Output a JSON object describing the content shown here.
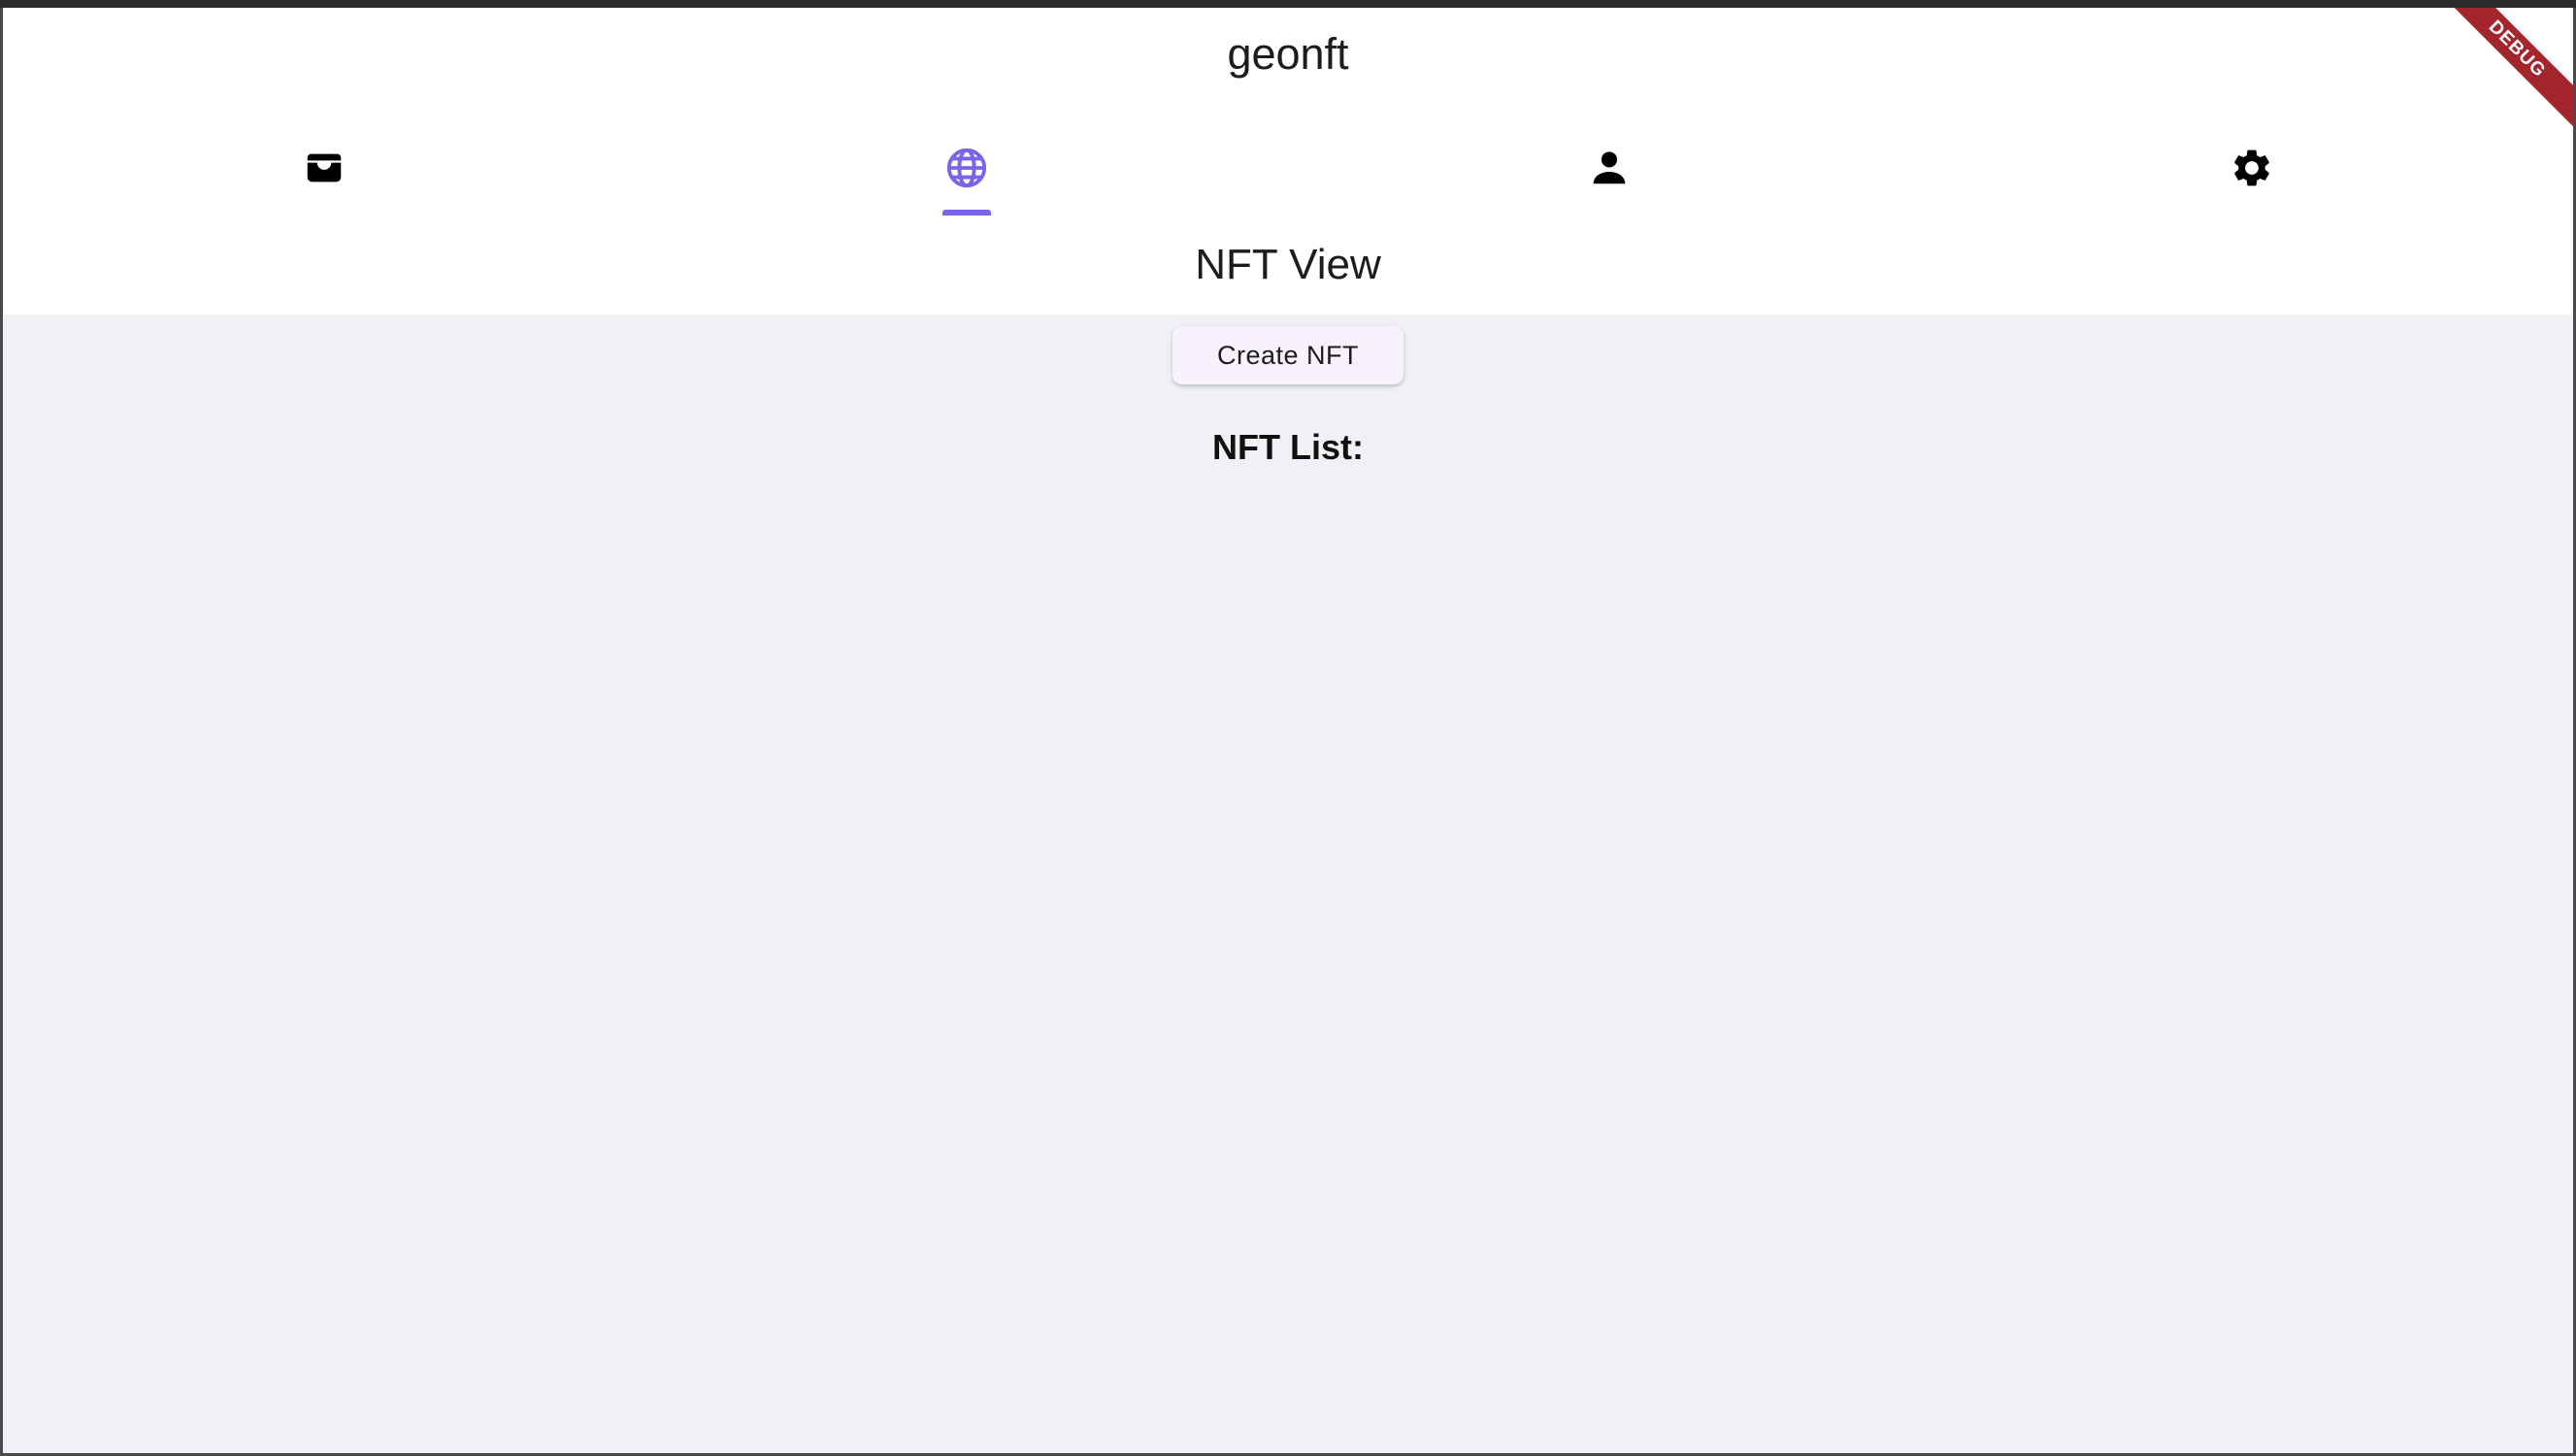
{
  "app": {
    "title": "geonft"
  },
  "tabs": [
    {
      "icon": "wallet-icon",
      "active": false
    },
    {
      "icon": "globe-icon",
      "active": true
    },
    {
      "icon": "person-icon",
      "active": false
    },
    {
      "icon": "gear-icon",
      "active": false
    }
  ],
  "view": {
    "title": "NFT View",
    "create_button_label": "Create NFT",
    "list_heading": "NFT List:"
  },
  "debug_banner": {
    "label": "DEBUG"
  },
  "colors": {
    "accent": "#7b64e8",
    "surface": "#ffffff",
    "background": "#f0f1f5",
    "debug_banner": "#a3262d"
  }
}
